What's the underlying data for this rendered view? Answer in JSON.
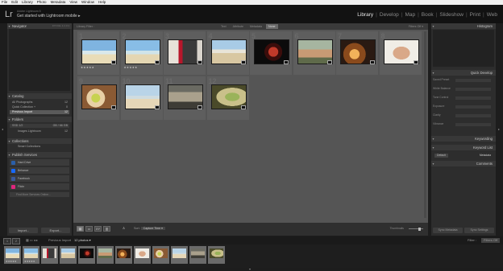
{
  "menu": [
    "File",
    "Edit",
    "Library",
    "Photo",
    "Metadata",
    "View",
    "Window",
    "Help"
  ],
  "identity": {
    "logo": "Lr",
    "subtitle": "Adobe Lightroom 5",
    "title": "Get started with Lightroom mobile ▸"
  },
  "modules": [
    {
      "label": "Library",
      "active": true
    },
    {
      "label": "Develop",
      "active": false
    },
    {
      "label": "Map",
      "active": false
    },
    {
      "label": "Book",
      "active": false
    },
    {
      "label": "Slideshow",
      "active": false
    },
    {
      "label": "Print",
      "active": false
    },
    {
      "label": "Web",
      "active": false
    }
  ],
  "left_panel": {
    "navigator": {
      "title": "Navigator",
      "modes": "FIT  FILL  1:1  3:1"
    },
    "catalog": {
      "title": "Catalog",
      "items": [
        {
          "label": "All Photographs",
          "count": "12"
        },
        {
          "label": "Quick Collection +",
          "count": "0"
        },
        {
          "label": "Previous Import",
          "count": "12"
        }
      ]
    },
    "folders": {
      "title": "Folders",
      "drive": {
        "label": "SSD 1/2",
        "count": "GB / 66 GB"
      },
      "items": [
        {
          "label": "Images Lightroom",
          "count": "12"
        }
      ]
    },
    "collections": {
      "title": "Collections",
      "items": [
        {
          "label": "Smart Collections"
        }
      ]
    },
    "publish": {
      "title": "Publish Services",
      "items": [
        {
          "label": "Hard Drive",
          "color": "#2b5fa8"
        },
        {
          "label": "Behance",
          "color": "#1769ff"
        },
        {
          "label": "Facebook",
          "color": "#3b5998"
        },
        {
          "label": "Flickr",
          "color": "#e0267d"
        }
      ],
      "find_more": "Find More Services Online..."
    },
    "import_label": "Import...",
    "export_label": "Export..."
  },
  "main": {
    "filter_label": "Library Filter :",
    "filter_tabs": [
      {
        "label": "Text",
        "active": false
      },
      {
        "label": "Attribute",
        "active": false
      },
      {
        "label": "Metadata",
        "active": false
      },
      {
        "label": "None",
        "active": true
      }
    ],
    "filter_right": "Filters Off ▾",
    "cells": [
      {
        "num": "1",
        "stars": "★★★★★",
        "thumb": "beach-palms"
      },
      {
        "num": "2",
        "stars": "★★★★★",
        "thumb": "beach-palms-2"
      },
      {
        "num": "3",
        "stars": "",
        "thumb": "laptop-desk"
      },
      {
        "num": "4",
        "stars": "",
        "thumb": "beach-girl"
      },
      {
        "num": "5",
        "stars": "",
        "thumb": "dark-portrait"
      },
      {
        "num": "6",
        "stars": "",
        "thumb": "people-group"
      },
      {
        "num": "7",
        "stars": "",
        "thumb": "campfire-hands"
      },
      {
        "num": "8",
        "stars": "",
        "thumb": "man-portrait"
      },
      {
        "num": "9",
        "stars": "",
        "thumb": "food-plate"
      },
      {
        "num": "10",
        "stars": "",
        "thumb": "beach-couple"
      },
      {
        "num": "11",
        "stars": "",
        "thumb": "bicycles"
      },
      {
        "num": "12",
        "stars": "",
        "thumb": "plant-closeup"
      }
    ],
    "sort_label": "Sort:",
    "sort_value": "Capture Time ▾",
    "thumbnails_label": "Thumbnails"
  },
  "right_panel": {
    "histogram_title": "Histogram",
    "quick_develop_title": "Quick Develop",
    "rows": [
      "Saved Preset",
      "White Balance",
      "Tone Control",
      "Exposure",
      "Clarity",
      "Vibrance"
    ],
    "keywording_title": "Keywording",
    "keyword_list_title": "Keyword List",
    "metadata_title": "Metadata",
    "metadata_preset": "Default",
    "comments_title": "Comments",
    "sync_metadata": "Sync Metadata",
    "sync_settings": "Sync Settings"
  },
  "filmbar": {
    "page1": "1",
    "page2": "2",
    "source": "Previous Import",
    "count": "12 photos ▾",
    "filter_label": "Filter :",
    "filter_value": "Filters Off"
  },
  "filmstrip": [
    {
      "sel": true,
      "stars": "★★★★★",
      "thumb": "beach-palms"
    },
    {
      "sel": true,
      "stars": "★★★★★",
      "thumb": "beach-palms-2"
    },
    {
      "sel": true,
      "stars": "",
      "thumb": "laptop-desk"
    },
    {
      "sel": true,
      "stars": "",
      "thumb": "beach-girl"
    },
    {
      "sel": true,
      "stars": "",
      "thumb": "dark-portrait"
    },
    {
      "sel": true,
      "stars": "",
      "thumb": "people-group"
    },
    {
      "sel": true,
      "stars": "",
      "thumb": "campfire-hands"
    },
    {
      "sel": true,
      "stars": "",
      "thumb": "man-portrait"
    },
    {
      "sel": true,
      "stars": "",
      "thumb": "food-plate"
    },
    {
      "sel": true,
      "stars": "",
      "thumb": "beach-couple"
    },
    {
      "sel": true,
      "stars": "",
      "thumb": "bicycles"
    },
    {
      "sel": true,
      "stars": "",
      "thumb": "plant-closeup"
    }
  ]
}
